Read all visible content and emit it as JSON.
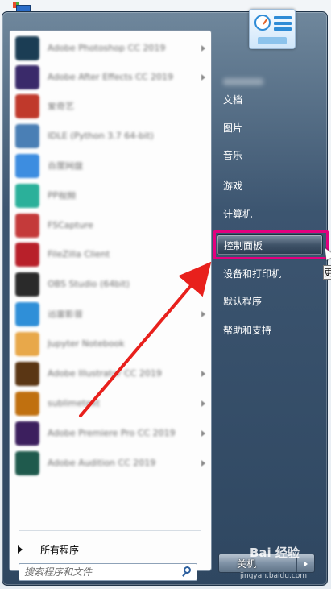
{
  "start_menu": {
    "programs": [
      {
        "label": "Adobe Photoshop CC 2019",
        "icon_color": "#1b3d54",
        "has_submenu": true
      },
      {
        "label": "Adobe After Effects CC 2019",
        "icon_color": "#3a2a6a",
        "has_submenu": true
      },
      {
        "label": "爱奇艺",
        "icon_color": "#c0392b",
        "has_submenu": false
      },
      {
        "label": "IDLE (Python 3.7 64-bit)",
        "icon_color": "#4a7fb5",
        "has_submenu": false
      },
      {
        "label": "百度网盘",
        "icon_color": "#3d8de0",
        "has_submenu": false
      },
      {
        "label": "PP视频",
        "icon_color": "#2bb09a",
        "has_submenu": false
      },
      {
        "label": "FSCapture",
        "icon_color": "#c43a3a",
        "has_submenu": false
      },
      {
        "label": "FileZilla Client",
        "icon_color": "#b8202a",
        "has_submenu": false
      },
      {
        "label": "OBS Studio (64bit)",
        "icon_color": "#2a2a2a",
        "has_submenu": false
      },
      {
        "label": "迅雷影音",
        "icon_color": "#2f8fd8",
        "has_submenu": true
      },
      {
        "label": "Jupyter Notebook",
        "icon_color": "#e8a84a",
        "has_submenu": false
      },
      {
        "label": "Adobe Illustrator CC 2019",
        "icon_color": "#5a3614",
        "has_submenu": true
      },
      {
        "label": "sublimetext",
        "icon_color": "#c0700f",
        "has_submenu": true
      },
      {
        "label": "Adobe Premiere Pro CC 2019",
        "icon_color": "#3c1f5e",
        "has_submenu": true
      },
      {
        "label": "Adobe Audition CC 2019",
        "icon_color": "#1f5a4d",
        "has_submenu": true
      }
    ],
    "all_programs_label": "所有程序",
    "search": {
      "placeholder": "搜索程序和文件"
    },
    "right_links": [
      {
        "label": "文档"
      },
      {
        "label": "图片"
      },
      {
        "label": "音乐"
      },
      {
        "label": "游戏"
      },
      {
        "label": "计算机"
      },
      {
        "label": "控制面板",
        "highlighted": true
      },
      {
        "label": "设备和打印机"
      },
      {
        "label": "默认程序"
      },
      {
        "label": "帮助和支持"
      }
    ],
    "tooltip_text": "更",
    "shutdown_label": "关机"
  },
  "watermark": {
    "brand": "Bai 经验",
    "url": "jingyan.baidu.com"
  },
  "annotation": {
    "arrow_color": "#e8201c",
    "highlight_color": "#e3007e"
  }
}
